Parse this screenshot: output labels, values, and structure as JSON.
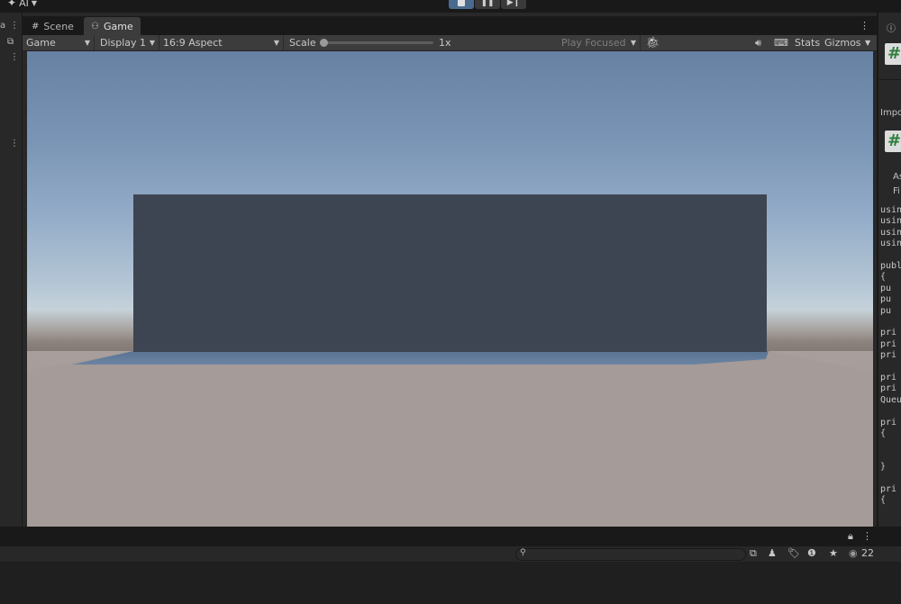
{
  "topbar": {
    "ai_label": "AI",
    "ai_icon": "sparkle-icon",
    "play_buttons": [
      "stop-icon",
      "pause-icon",
      "step-icon"
    ]
  },
  "tabs": [
    {
      "label": "Scene",
      "icon": "grid-icon",
      "active": false
    },
    {
      "label": "Game",
      "icon": "gamepad-icon",
      "active": true
    }
  ],
  "game_toolbar": {
    "view_mode": "Game",
    "display": "Display 1",
    "aspect": "16:9 Aspect",
    "scale_label": "Scale",
    "scale_value": "1x",
    "play_mode": "Play Focused",
    "stats_label": "Stats",
    "gizmos_label": "Gizmos"
  },
  "inspector": {
    "header_icon": "info-icon",
    "import_label": "Impo",
    "asset_label": "As",
    "file_label": "Fi",
    "code_lines": [
      "using",
      "using",
      "using",
      "using",
      "",
      "publi",
      "{",
      "  pu",
      "  pu",
      "  pu",
      "",
      "  pri",
      "  pri",
      "  pri",
      "",
      "  pri",
      "  pri",
      "Queu",
      "",
      "  pri",
      "  {",
      "",
      "",
      "  }",
      "",
      "  pri",
      "  {"
    ]
  },
  "console": {
    "search_placeholder": "",
    "count": "22"
  },
  "colors": {
    "accent_play": "#4a6b8f",
    "panel_bg": "#282828",
    "toolbar_bg": "#3c3c3c",
    "wall": "#3e4552",
    "floor_blue": "#5d7694"
  }
}
